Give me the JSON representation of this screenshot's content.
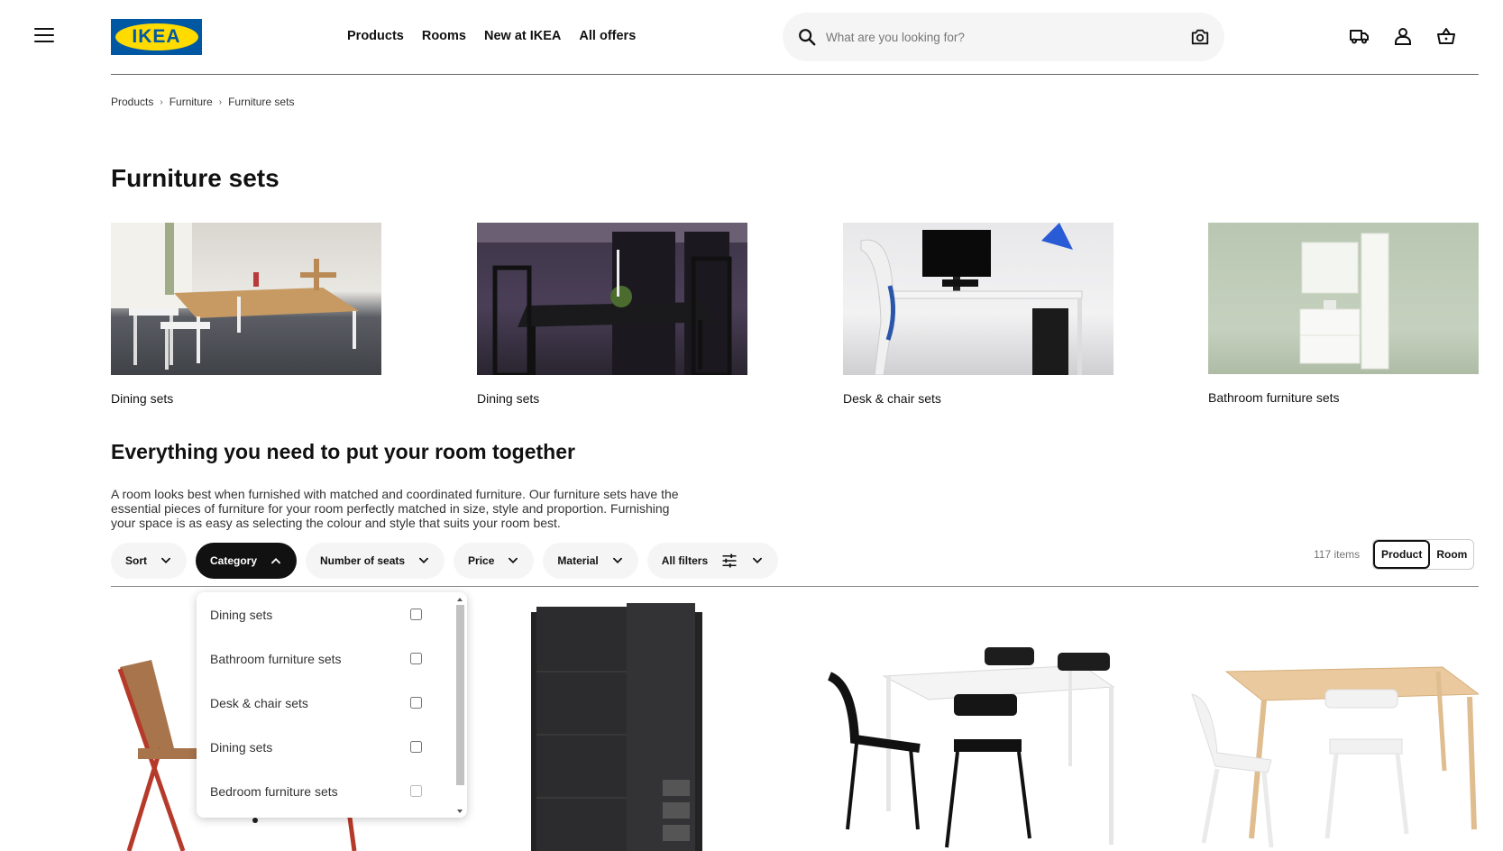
{
  "header": {
    "logo_text": "IKEA",
    "nav": [
      "Products",
      "Rooms",
      "New at IKEA",
      "All offers"
    ],
    "search_placeholder": "What are you looking for?",
    "brand_blue": "#0058a3",
    "brand_yellow": "#ffdb00"
  },
  "breadcrumb": [
    "Products",
    "Furniture",
    "Furniture sets"
  ],
  "page_title": "Furniture sets",
  "tiles": [
    {
      "label": "Dining sets"
    },
    {
      "label": "Dining sets"
    },
    {
      "label": "Desk & chair sets"
    },
    {
      "label": "Bathroom furniture sets"
    }
  ],
  "section": {
    "title": "Everything you need to put your room together",
    "description": "A room looks best when furnished with matched and coordinated furniture. Our furniture sets have the essential pieces of furniture for your room perfectly matched in size, style and proportion. Furnishing your space is as easy as selecting the colour and style that suits your room best."
  },
  "filters": [
    "Sort",
    "Category",
    "Number of seats",
    "Price",
    "Material",
    "All filters"
  ],
  "active_filter": "Category",
  "item_count": "117 items",
  "view_toggle": [
    "Product",
    "Room"
  ],
  "category_dropdown": [
    {
      "label": "Dining sets",
      "checked": false
    },
    {
      "label": "Bathroom furniture sets",
      "checked": false
    },
    {
      "label": "Desk & chair sets",
      "checked": false
    },
    {
      "label": "Dining sets",
      "checked": false
    },
    {
      "label": "Bedroom furniture sets",
      "checked": false
    }
  ]
}
